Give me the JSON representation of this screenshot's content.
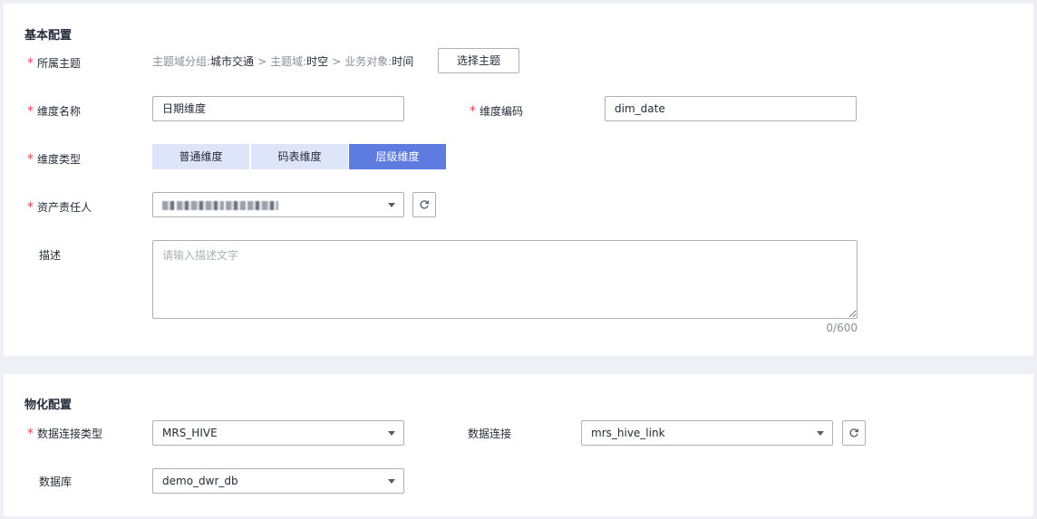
{
  "basic": {
    "section_title": "基本配置",
    "subject": {
      "label": "所属主题",
      "group_key": "主题域分组:",
      "group_value": "城市交通",
      "domain_key": "主题域:",
      "domain_value": "时空",
      "object_key": "业务对象:",
      "object_value": "时间",
      "separator": ">",
      "select_button": "选择主题"
    },
    "dim_name": {
      "label": "维度名称",
      "value": "日期维度"
    },
    "dim_code": {
      "label": "维度编码",
      "value": "dim_date"
    },
    "dim_type": {
      "label": "维度类型",
      "options": [
        "普通维度",
        "码表维度",
        "层级维度"
      ],
      "selected": "层级维度"
    },
    "owner": {
      "label": "资产责任人"
    },
    "description": {
      "label": "描述",
      "placeholder": "请输入描述文字",
      "counter": "0/600"
    },
    "required_mark": "*"
  },
  "physical": {
    "section_title": "物化配置",
    "conn_type": {
      "label": "数据连接类型",
      "value": "MRS_HIVE"
    },
    "connection": {
      "label": "数据连接",
      "value": "mrs_hive_link"
    },
    "database": {
      "label": "数据库",
      "value": "demo_dwr_db"
    }
  },
  "colors": {
    "accent": "#5e7ce0",
    "segment_bg": "#dfe5f8",
    "required": "#e5414a",
    "border": "#adb0b8",
    "page_bg": "#eef0f5"
  },
  "icons": {
    "refresh": "refresh-icon",
    "dropdown": "chevron-down-icon"
  }
}
